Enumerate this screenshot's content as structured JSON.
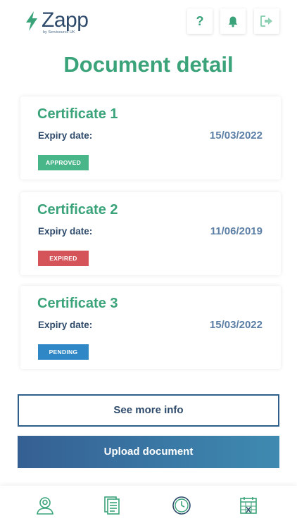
{
  "header": {
    "logo_name": "Zapp",
    "logo_sub": "by Servisource UK",
    "help_label": "?",
    "icons": {
      "bell": "bell-icon",
      "logout": "logout-icon",
      "logo": "lightning-bolt-icon"
    }
  },
  "page": {
    "title": "Document detail"
  },
  "certificates": [
    {
      "name": "Certificate 1",
      "expiry_label": "Expiry date:",
      "expiry_date": "15/03/2022",
      "status": "APPROVED",
      "status_color": "#49b68a"
    },
    {
      "name": "Certificate 2",
      "expiry_label": "Expiry date:",
      "expiry_date": "11/06/2019",
      "status": "EXPIRED",
      "status_color": "#d4545a"
    },
    {
      "name": "Certificate 3",
      "expiry_label": "Expiry date:",
      "expiry_date": "15/03/2022",
      "status": "PENDING",
      "status_color": "#2f88c5"
    }
  ],
  "actions": {
    "see_more": "See more info",
    "upload": "Upload document"
  },
  "tabbar": {
    "icons": [
      "profile-icon",
      "documents-icon",
      "clock-icon",
      "calendar-icon"
    ]
  },
  "colors": {
    "accent_green": "#3aa37a",
    "navy": "#2e4a6b",
    "blue": "#3a7aa6"
  }
}
